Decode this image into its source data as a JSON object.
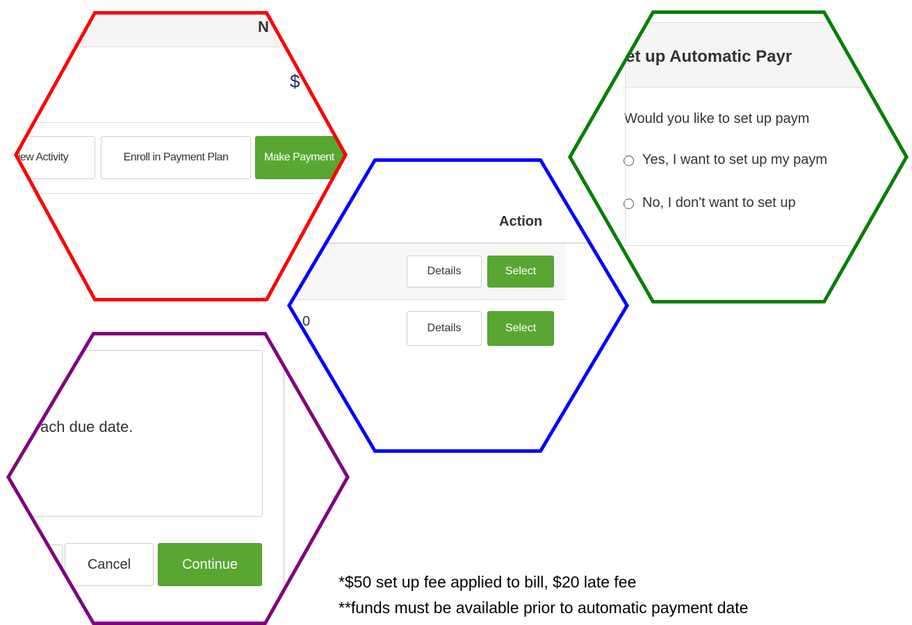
{
  "colors": {
    "red_outline": "#ff0000",
    "blue_outline": "#0000ff",
    "green_outline": "#008000",
    "purple_outline": "#800080",
    "primary_button": "#58a733"
  },
  "panel_account": {
    "view_activity_label": "View Activity",
    "enroll_label": "Enroll in Payment Plan",
    "make_payment_label": "Make Payment",
    "top_fragment": "N",
    "amount_fragment": "$"
  },
  "panel_plans": {
    "action_header": "Action",
    "row2_fragment": "0",
    "rows": [
      {
        "details_label": "Details",
        "select_label": "Select"
      },
      {
        "details_label": "Details",
        "select_label": "Select"
      }
    ]
  },
  "panel_autopay": {
    "title": "et up Automatic Payr",
    "question": "Would you like to set up paym",
    "option_yes": "Yes, I want to set up my paym",
    "option_no": "No, I don't want to set up"
  },
  "panel_confirm": {
    "body_text": "ach due date.",
    "cancel_label": "Cancel",
    "continue_label": "Continue"
  },
  "footnotes": {
    "line1": "*$50 set up fee applied to bill, $20 late fee",
    "line2": "**funds must be available prior to automatic payment date"
  }
}
